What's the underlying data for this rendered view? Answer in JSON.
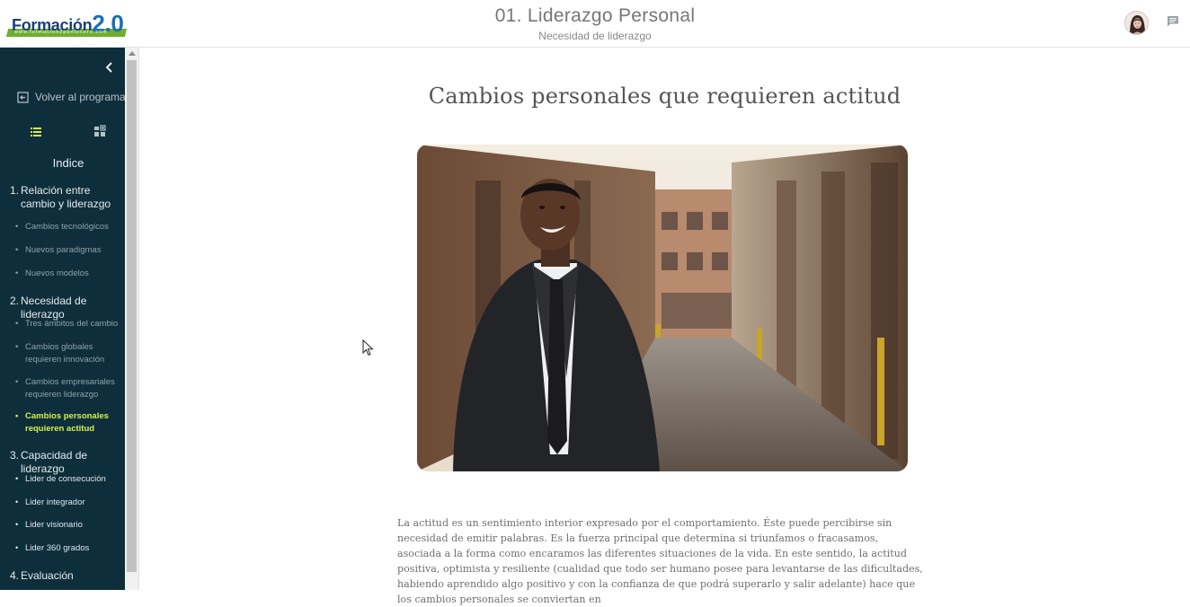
{
  "header": {
    "logo_text": "Formación",
    "logo_version": "2.0",
    "logo_url": "www.formacion2puntocero.com",
    "title": "01. Liderazgo Personal",
    "subtitle": "Necesidad de liderazgo"
  },
  "sidebar": {
    "back_label": "Volver al programa",
    "index_label": "Indice",
    "sections": [
      {
        "num": "1.",
        "title": "Relación entre cambio y liderazgo",
        "items": [
          {
            "label": "Cambios tecnológicos"
          },
          {
            "label": "Nuevos paradigmas"
          },
          {
            "label": "Nuevos modelos"
          }
        ]
      },
      {
        "num": "2.",
        "title": "Necesidad de liderazgo",
        "items": [
          {
            "label": "Tres ámbitos del cambio"
          },
          {
            "label": "Cambios globales requieren innovación"
          },
          {
            "label": "Cambios empresariales requieren liderazgo"
          },
          {
            "label": "Cambios personales requieren actitud",
            "active": true
          }
        ]
      },
      {
        "num": "3.",
        "title": "Capacidad de liderazgo",
        "items": [
          {
            "label": "Lider de consecución"
          },
          {
            "label": "Lider integrador"
          },
          {
            "label": "Lider visionario"
          },
          {
            "label": "Lider 360 grados"
          }
        ]
      },
      {
        "num": "4.",
        "title": "Evaluación",
        "items": []
      }
    ]
  },
  "content": {
    "title": "Cambios personales que requieren actitud",
    "paragraph": "La actitud es un sentimiento interior expresado por el comportamiento. Éste puede percibirse sin necesidad de emitir palabras. Es la fuerza principal que determina si triunfamos o fracasamos, asociada a la forma como encaramos las diferentes situaciones de la vida. En este sentido, la actitud positiva, optimista y resiliente (cualidad que todo ser humano posee para levantarse de las dificultades, habiendo aprendido algo positivo y con la confianza de que podrá superarlo y salir adelante) hace que los cambios personales se conviertan en"
  },
  "colors": {
    "sidebar_bg": "#0e2e3c",
    "active_item": "#d7f04a",
    "logo_blue": "#1c3f7a",
    "logo_green": "#6fae2e"
  },
  "icons": [
    "chevron-left-icon",
    "exit-icon",
    "list-view-icon",
    "grid-view-icon",
    "chat-icon",
    "avatar"
  ]
}
